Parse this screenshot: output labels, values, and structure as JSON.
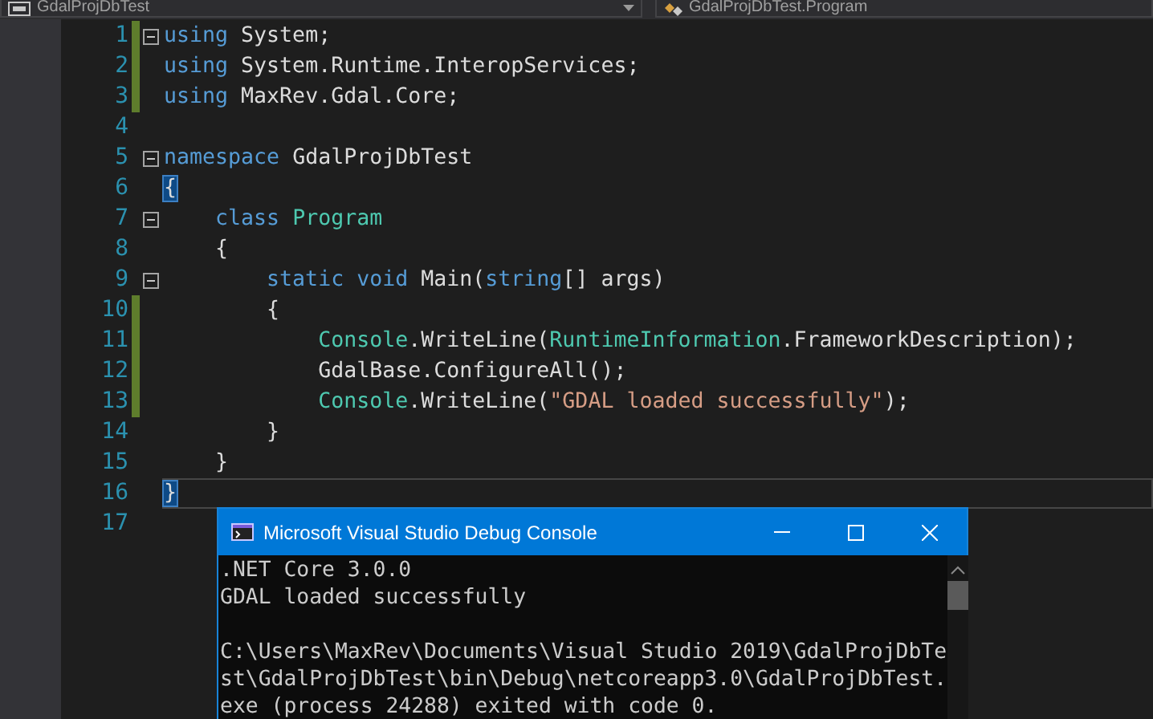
{
  "toolbar": {
    "project_dropdown": "GdalProjDbTest",
    "member_dropdown": "GdalProjDbTest.Program"
  },
  "editor": {
    "lines": [
      {
        "number": "1",
        "changed": true,
        "fold": true,
        "current": false,
        "tokens": [
          {
            "kind": "keyword",
            "text": "using"
          },
          {
            "kind": "plain",
            "text": " System;"
          }
        ]
      },
      {
        "number": "2",
        "changed": true,
        "fold": false,
        "current": false,
        "tokens": [
          {
            "kind": "keyword",
            "text": "using"
          },
          {
            "kind": "plain",
            "text": " System.Runtime.InteropServices;"
          }
        ]
      },
      {
        "number": "3",
        "changed": true,
        "fold": false,
        "current": false,
        "tokens": [
          {
            "kind": "keyword",
            "text": "using"
          },
          {
            "kind": "plain",
            "text": " MaxRev.Gdal.Core;"
          }
        ]
      },
      {
        "number": "4",
        "changed": false,
        "fold": false,
        "current": false
      },
      {
        "number": "5",
        "changed": false,
        "fold": true,
        "current": false,
        "tokens": [
          {
            "kind": "keyword",
            "text": "namespace"
          },
          {
            "kind": "plain",
            "text": " GdalProjDbTest"
          }
        ]
      },
      {
        "number": "6",
        "changed": false,
        "fold": false,
        "current": false,
        "tokens": [
          {
            "kind": "brace-match",
            "text": "{"
          }
        ]
      },
      {
        "number": "7",
        "changed": false,
        "fold": true,
        "current": false,
        "tokens": [
          {
            "kind": "keyword",
            "text": "    class"
          },
          {
            "kind": "type",
            "text": " Program"
          }
        ]
      },
      {
        "number": "8",
        "changed": false,
        "fold": false,
        "current": false,
        "tokens": [
          {
            "kind": "plain",
            "text": "    {"
          }
        ]
      },
      {
        "number": "9",
        "changed": false,
        "fold": true,
        "current": false,
        "tokens": [
          {
            "kind": "keyword",
            "text": "        static void"
          },
          {
            "kind": "plain",
            "text": " Main("
          },
          {
            "kind": "keyword",
            "text": "string"
          },
          {
            "kind": "plain",
            "text": "[] args)"
          }
        ]
      },
      {
        "number": "10",
        "changed": true,
        "fold": false,
        "current": false,
        "tokens": [
          {
            "kind": "plain",
            "text": "        {"
          }
        ]
      },
      {
        "number": "11",
        "changed": true,
        "fold": false,
        "current": false,
        "tokens": [
          {
            "kind": "type",
            "text": "            Console"
          },
          {
            "kind": "plain",
            "text": ".WriteLine("
          },
          {
            "kind": "type",
            "text": "RuntimeInformation"
          },
          {
            "kind": "plain",
            "text": ".FrameworkDescription);"
          }
        ]
      },
      {
        "number": "12",
        "changed": true,
        "fold": false,
        "current": false,
        "tokens": [
          {
            "kind": "plain",
            "text": "            GdalBase.ConfigureAll();"
          }
        ]
      },
      {
        "number": "13",
        "changed": true,
        "fold": false,
        "current": false,
        "tokens": [
          {
            "kind": "type",
            "text": "            Console"
          },
          {
            "kind": "plain",
            "text": ".WriteLine("
          },
          {
            "kind": "string",
            "text": "\"GDAL loaded successfully\""
          },
          {
            "kind": "plain",
            "text": ");"
          }
        ]
      },
      {
        "number": "14",
        "changed": false,
        "fold": false,
        "current": false,
        "tokens": [
          {
            "kind": "plain",
            "text": "        }"
          }
        ]
      },
      {
        "number": "15",
        "changed": false,
        "fold": false,
        "current": false,
        "tokens": [
          {
            "kind": "plain",
            "text": "    }"
          }
        ]
      },
      {
        "number": "16",
        "changed": false,
        "fold": false,
        "current": true,
        "tokens": [
          {
            "kind": "brace-match",
            "text": "}"
          }
        ]
      },
      {
        "number": "17",
        "changed": false,
        "fold": false,
        "current": false
      }
    ]
  },
  "console": {
    "title": "Microsoft Visual Studio Debug Console",
    "output": [
      ".NET Core 3.0.0",
      "GDAL loaded successfully"
    ],
    "message": "C:\\Users\\MaxRev\\Documents\\Visual Studio 2019\\GdalProjDbTest\\GdalProjDbTest\\bin\\Debug\\netcoreapp3.0\\GdalProjDbTest.exe (process 24288) exited with code 0."
  }
}
